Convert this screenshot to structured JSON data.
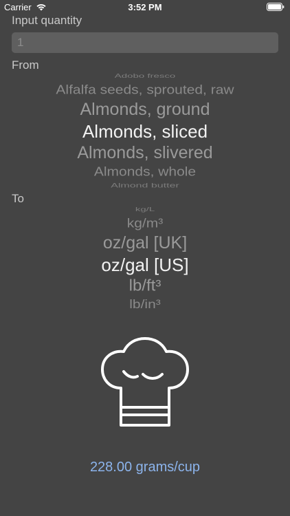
{
  "status_bar": {
    "carrier": "Carrier",
    "time": "3:52 PM"
  },
  "input": {
    "label": "Input quantity",
    "placeholder": "1"
  },
  "from": {
    "label": "From",
    "items": [
      "Adobo fresco",
      "Alfalfa seeds, sprouted, raw",
      "Almonds, ground",
      "Almonds, sliced",
      "Almonds, slivered",
      "Almonds, whole",
      "Almond butter"
    ],
    "selected": "Almonds, sliced"
  },
  "to": {
    "label": "To",
    "items": [
      "kg/L",
      "kg/m³",
      "oz/gal [UK]",
      "oz/gal [US]",
      "lb/ft³",
      "lb/in³"
    ],
    "selected": "oz/gal [US]"
  },
  "result": {
    "text": "228.00 grams/cup"
  },
  "icons": {
    "hat": "chef-hat-icon",
    "wifi": "wifi-icon",
    "battery": "battery-icon"
  },
  "colors": {
    "background": "#444444",
    "result": "#8cb4ec",
    "selected_text": "#f2f2f2"
  }
}
